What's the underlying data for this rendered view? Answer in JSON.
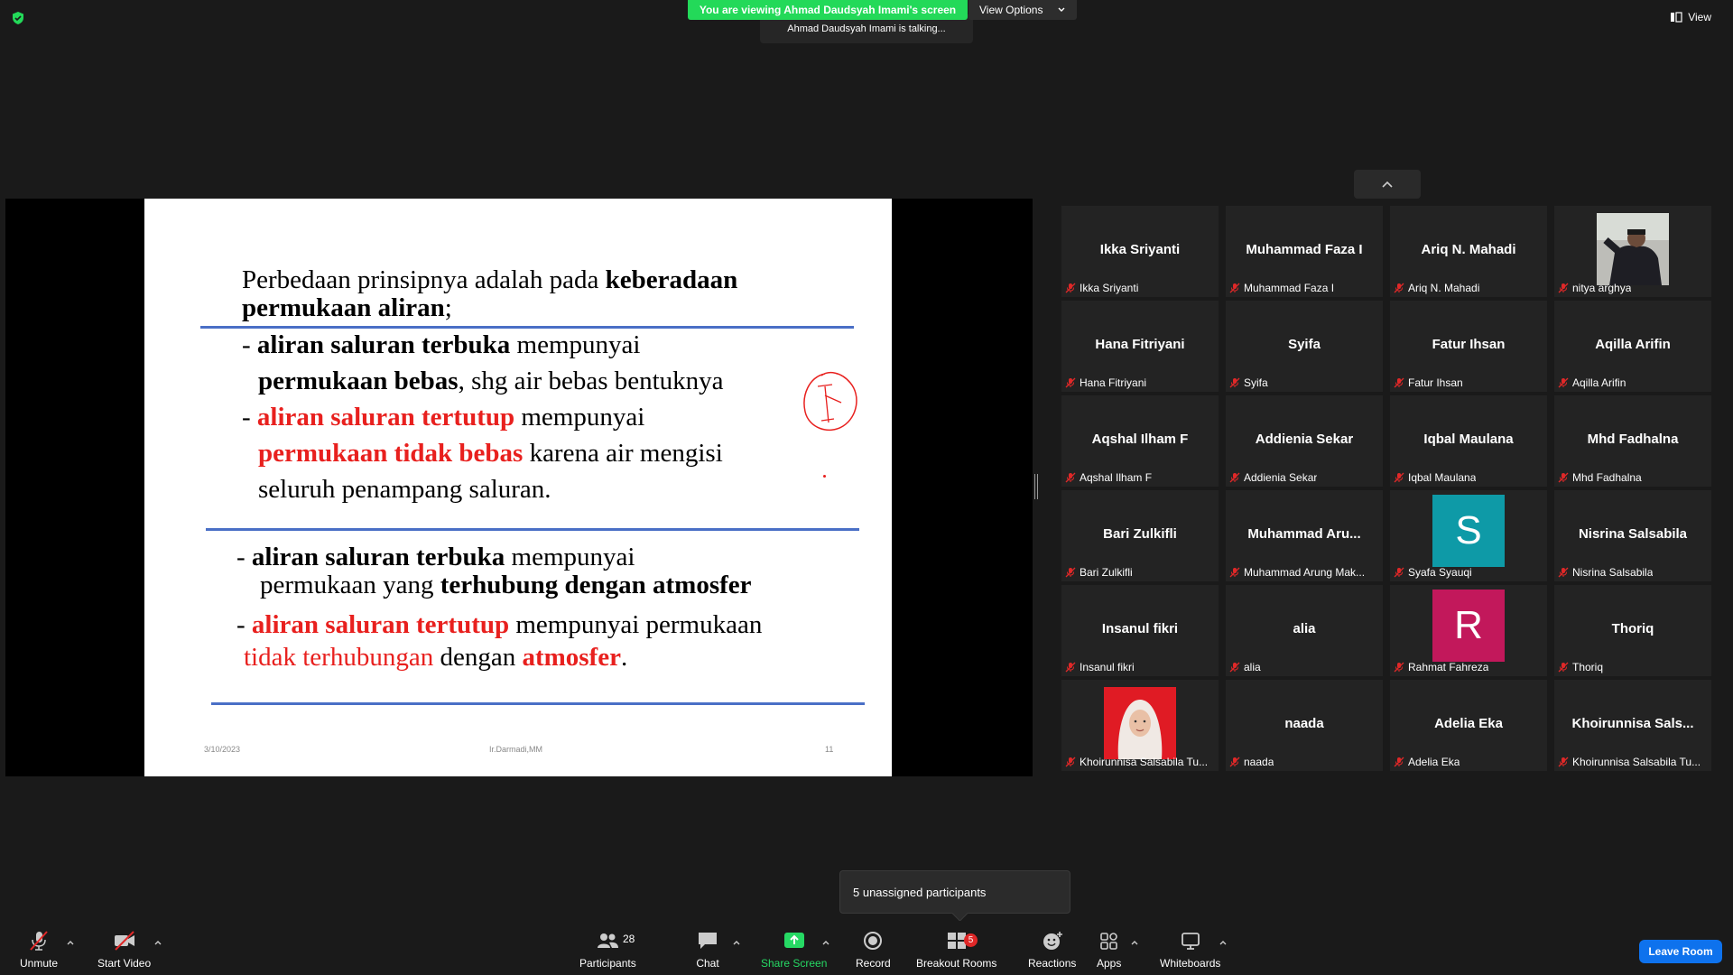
{
  "top": {
    "banner": "You are viewing Ahmad Daudsyah Imami's screen",
    "view_options": "View Options",
    "talking": "Ahmad Daudsyah Imami is talking...",
    "view": "View"
  },
  "slide": {
    "l1a": "Perbedaan prinsipnya adalah pada ",
    "l1b": "keberadaan",
    "l2a": "permukaan aliran",
    "l2b": ";",
    "l3a": "- ",
    "l3b": "aliran saluran terbuka",
    "l3c": " mempunyai",
    "l4a": "permukaan bebas",
    "l4b": ", shg air bebas bentuknya",
    "l5a": "- ",
    "l5b": "aliran saluran tertutup",
    "l5c": " mempunyai",
    "l6a": "permukaan tidak bebas",
    "l6b": " karena air mengisi",
    "l7": "seluruh penampang saluran.",
    "l8a": "-  ",
    "l8b": "aliran saluran terbuka",
    "l8c": " mempunyai",
    "l9a": "permukaan yang ",
    "l9b": "terhubung dengan atmosfer",
    "l10a": "-  ",
    "l10b": "aliran saluran tertutup",
    "l10c": " mempunyai permukaan",
    "l11a": "tidak terhubungan",
    "l11b": "  dengan  ",
    "l11c": "atmosfer",
    "l11d": ".",
    "date": "3/10/2023",
    "author": "Ir.Darmadi,MM",
    "page": "11"
  },
  "gallery": [
    {
      "name": "Ikka Sriyanti",
      "label": "Ikka Sriyanti"
    },
    {
      "name": "Muhammad Faza I",
      "label": "Muhammad Faza I"
    },
    {
      "name": "Ariq N. Mahadi",
      "label": "Ariq N. Mahadi"
    },
    {
      "name": "",
      "label": "nitya arghya",
      "media": "photo-person-black-jacket"
    },
    {
      "name": "Hana Fitriyani",
      "label": "Hana Fitriyani"
    },
    {
      "name": "Syifa",
      "label": "Syifa"
    },
    {
      "name": "Fatur Ihsan",
      "label": "Fatur Ihsan"
    },
    {
      "name": "Aqilla Arifin",
      "label": "Aqilla Arifin"
    },
    {
      "name": "Aqshal Ilham F",
      "label": "Aqshal Ilham F"
    },
    {
      "name": "Addienia Sekar",
      "label": "Addienia Sekar"
    },
    {
      "name": "Iqbal Maulana",
      "label": "Iqbal Maulana"
    },
    {
      "name": "Mhd Fadhalna",
      "label": "Mhd Fadhalna"
    },
    {
      "name": "Bari Zulkifli",
      "label": "Bari Zulkifli"
    },
    {
      "name": "Muhammad  Aru...",
      "label": "Muhammad Arung Mak..."
    },
    {
      "name": "",
      "label": "Syafa Syauqi",
      "initial": "S",
      "initial_color": "#0e9aa7"
    },
    {
      "name": "Nisrina Salsabila",
      "label": "Nisrina Salsabila"
    },
    {
      "name": "Insanul fikri",
      "label": "Insanul fikri"
    },
    {
      "name": "alia",
      "label": "alia"
    },
    {
      "name": "",
      "label": "Rahmat Fahreza",
      "initial": "R",
      "initial_color": "#c2185b"
    },
    {
      "name": "Thoriq",
      "label": "Thoriq"
    },
    {
      "name": "",
      "label": "Khoirunnisa Salsabila Tu...",
      "media": "photo-person-hijab-red-bg"
    },
    {
      "name": "naada",
      "label": "naada"
    },
    {
      "name": "Adelia Eka",
      "label": "Adelia Eka"
    },
    {
      "name": "Khoirunnisa  Sals...",
      "label": "Khoirunnisa Salsabila Tu..."
    }
  ],
  "tooltip": "5 unassigned participants",
  "toolbar": {
    "unmute": "Unmute",
    "start_video": "Start Video",
    "participants": "Participants",
    "participants_count": "28",
    "chat": "Chat",
    "share": "Share Screen",
    "record": "Record",
    "breakout": "Breakout Rooms",
    "breakout_badge": "5",
    "reactions": "Reactions",
    "apps": "Apps",
    "whiteboards": "Whiteboards",
    "leave": "Leave Room"
  },
  "colors": {
    "banner_green": "#23d959",
    "leave_blue": "#0e72ed",
    "slide_red": "#e8201e",
    "rule_blue": "#4a6fc6"
  }
}
